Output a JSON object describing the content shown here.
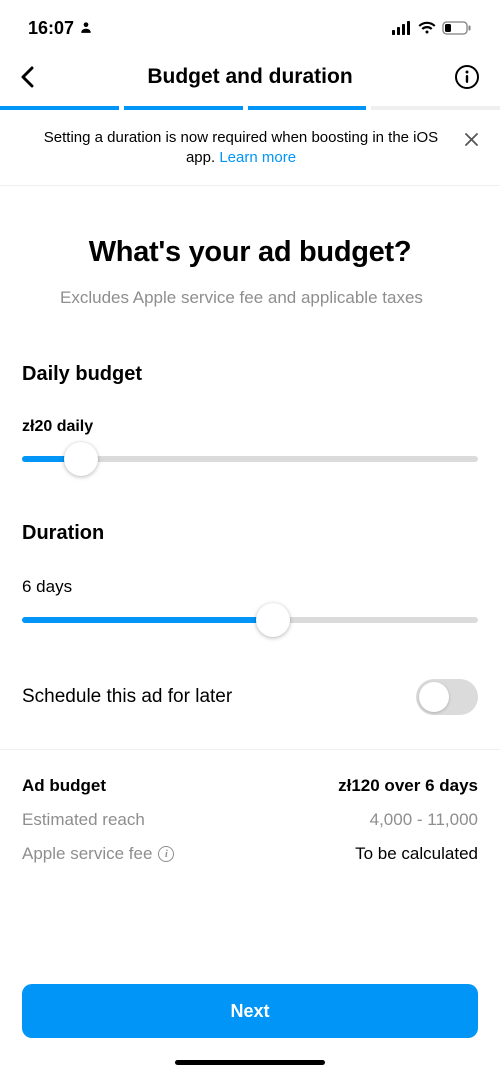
{
  "status": {
    "time": "16:07"
  },
  "header": {
    "title": "Budget and duration"
  },
  "progress": {
    "filled": 3,
    "segments": [
      {
        "width": "24%"
      },
      {
        "width": "24%"
      },
      {
        "width": "24%"
      },
      {
        "width": "28%"
      }
    ]
  },
  "banner": {
    "text_pre": "Setting a duration is now required when boosting in the iOS app. ",
    "link": "Learn more"
  },
  "heading": {
    "title": "What's your ad budget?",
    "subtitle": "Excludes Apple service fee and applicable taxes"
  },
  "daily_budget": {
    "label": "Daily budget",
    "value": "zł20 daily",
    "percent": 13
  },
  "duration": {
    "label": "Duration",
    "value": "6 days",
    "percent": 55
  },
  "schedule": {
    "label": "Schedule this ad for later",
    "on": false
  },
  "summary": {
    "rows": [
      {
        "label": "Ad budget",
        "value": "zł120 over 6 days",
        "strong": true
      },
      {
        "label": "Estimated reach",
        "value": "4,000 - 11,000",
        "muted": true
      },
      {
        "label": "Apple service fee",
        "value": "To be calculated",
        "muted_left": true,
        "info": true
      }
    ]
  },
  "footer": {
    "next": "Next"
  }
}
